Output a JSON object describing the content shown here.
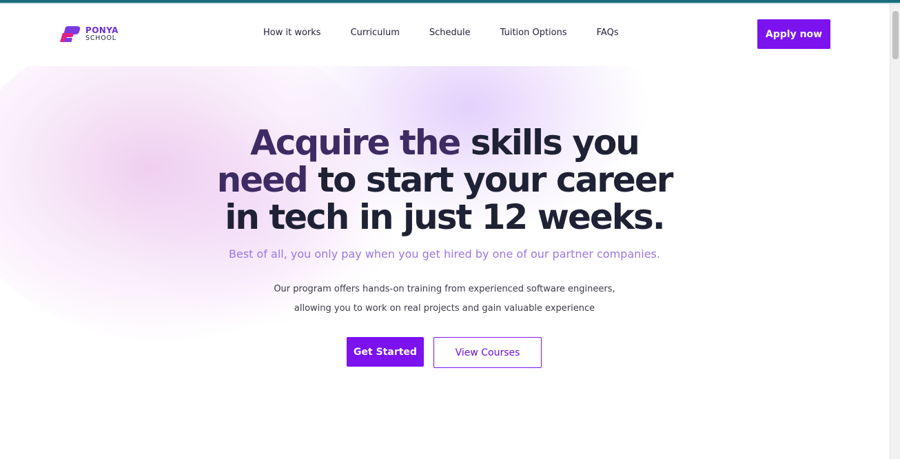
{
  "brand": {
    "name_line1": "PONYA",
    "name_line2": "SCHOOL",
    "colors": {
      "primary": "#7c12ee",
      "logo_pink": "#e0218a",
      "logo_purple": "#6a2fd6"
    }
  },
  "nav": {
    "items": [
      {
        "label": "How it works"
      },
      {
        "label": "Curriculum"
      },
      {
        "label": "Schedule"
      },
      {
        "label": "Tuition Options"
      },
      {
        "label": "FAQs"
      }
    ],
    "apply_label": "Apply now"
  },
  "hero": {
    "headline": {
      "line1_highlight": "Acquire the",
      "line1_rest": " skills you",
      "line2_highlight": "need",
      "line2_rest": " to start your career",
      "line3": "in tech in just 12 weeks."
    },
    "subhead": "Best of all, you only pay when you get hired by one of our partner companies.",
    "description_line1": "Our program offers hands-on training from experienced software engineers,",
    "description_line2": "allowing you to work on real projects and gain valuable experience",
    "primary_cta": "Get Started",
    "secondary_cta": "View Courses"
  }
}
